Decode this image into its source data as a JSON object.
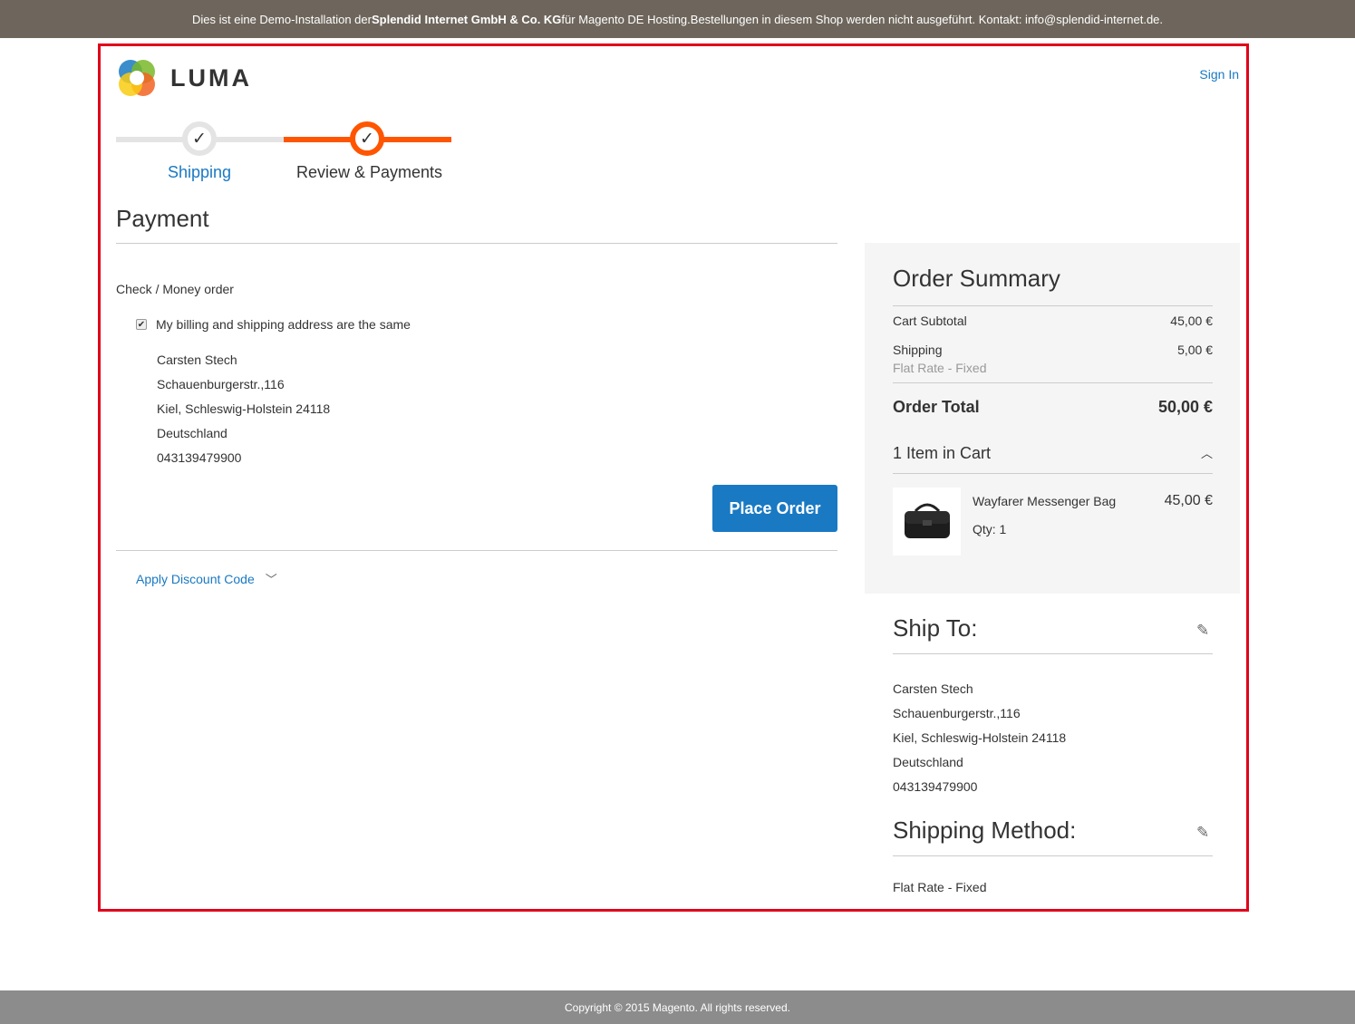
{
  "demo_bar": {
    "text_before": "Dies ist eine Demo-Installation der ",
    "company": "Splendid Internet GmbH & Co. KG",
    "text_after": " für Magento DE Hosting.Bestellungen in diesem Shop werden nicht ausgeführt. Kontakt: info@splendid-internet.de."
  },
  "header": {
    "logo_text": "LUMA",
    "signin": "Sign In"
  },
  "progress": {
    "steps": [
      {
        "label": "Shipping"
      },
      {
        "label": "Review & Payments"
      }
    ]
  },
  "payment": {
    "title": "Payment",
    "method": "Check / Money order",
    "same_address_label": "My billing and shipping address are the same",
    "address": [
      "Carsten Stech",
      "Schauenburgerstr.,116",
      "Kiel, Schleswig-Holstein 24118",
      "Deutschland",
      "043139479900"
    ],
    "place_order": "Place Order",
    "discount": "Apply Discount Code"
  },
  "summary": {
    "title": "Order Summary",
    "subtotal_label": "Cart Subtotal",
    "subtotal_value": "45,00 €",
    "shipping_label": "Shipping",
    "shipping_value": "5,00 €",
    "shipping_method": "Flat Rate - Fixed",
    "total_label": "Order Total",
    "total_value": "50,00 €",
    "items_label": "1 Item in Cart",
    "item": {
      "name": "Wayfarer Messenger Bag",
      "qty": "Qty: 1",
      "price": "45,00 €"
    }
  },
  "ship_to": {
    "title": "Ship To:",
    "address": [
      "Carsten Stech",
      "Schauenburgerstr.,116",
      "Kiel, Schleswig-Holstein 24118",
      "Deutschland",
      "043139479900"
    ]
  },
  "shipping_method": {
    "title": "Shipping Method:",
    "value": "Flat Rate - Fixed"
  },
  "footer": {
    "text": "Copyright © 2015 Magento. All rights reserved."
  },
  "colors": {
    "accent": "#1979c3",
    "progress_active": "#ff5501",
    "highlight_border": "#e0001b"
  }
}
